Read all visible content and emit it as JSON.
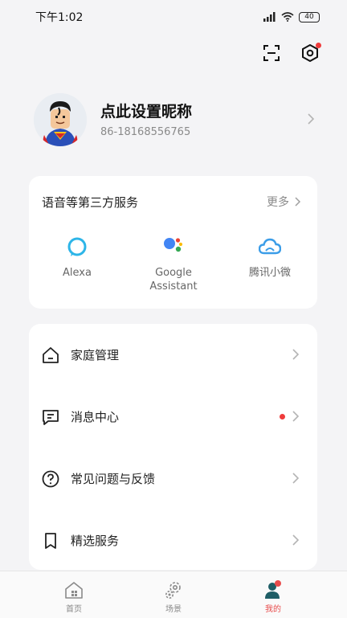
{
  "status_bar": {
    "time": "下午1:02",
    "battery": "40"
  },
  "profile": {
    "nickname": "点此设置昵称",
    "phone": "86-18168556765"
  },
  "services": {
    "title": "语音等第三方服务",
    "more_label": "更多",
    "items": [
      {
        "label": "Alexa",
        "icon": "alexa-icon",
        "color": "#2db5e8"
      },
      {
        "label": "Google\nAssistant",
        "icon": "google-assistant-icon",
        "color": "#4285f4"
      },
      {
        "label": "腾讯小微",
        "icon": "tencent-xiaowei-icon",
        "color": "#3b9de8"
      }
    ]
  },
  "menu": {
    "items": [
      {
        "label": "家庭管理",
        "icon": "home-icon"
      },
      {
        "label": "消息中心",
        "icon": "message-icon",
        "has_badge": true
      },
      {
        "label": "常见问题与反馈",
        "icon": "help-icon"
      },
      {
        "label": "精选服务",
        "icon": "bookmark-icon"
      }
    ]
  },
  "tabbar": {
    "tabs": [
      {
        "label": "首页",
        "icon": "home-tab-icon"
      },
      {
        "label": "场景",
        "icon": "scene-tab-icon"
      },
      {
        "label": "我的",
        "icon": "profile-tab-icon",
        "active": true
      }
    ]
  },
  "colors": {
    "accent": "#e84c4c",
    "badge": "#ef3b3b",
    "background": "#f4f4f6"
  }
}
